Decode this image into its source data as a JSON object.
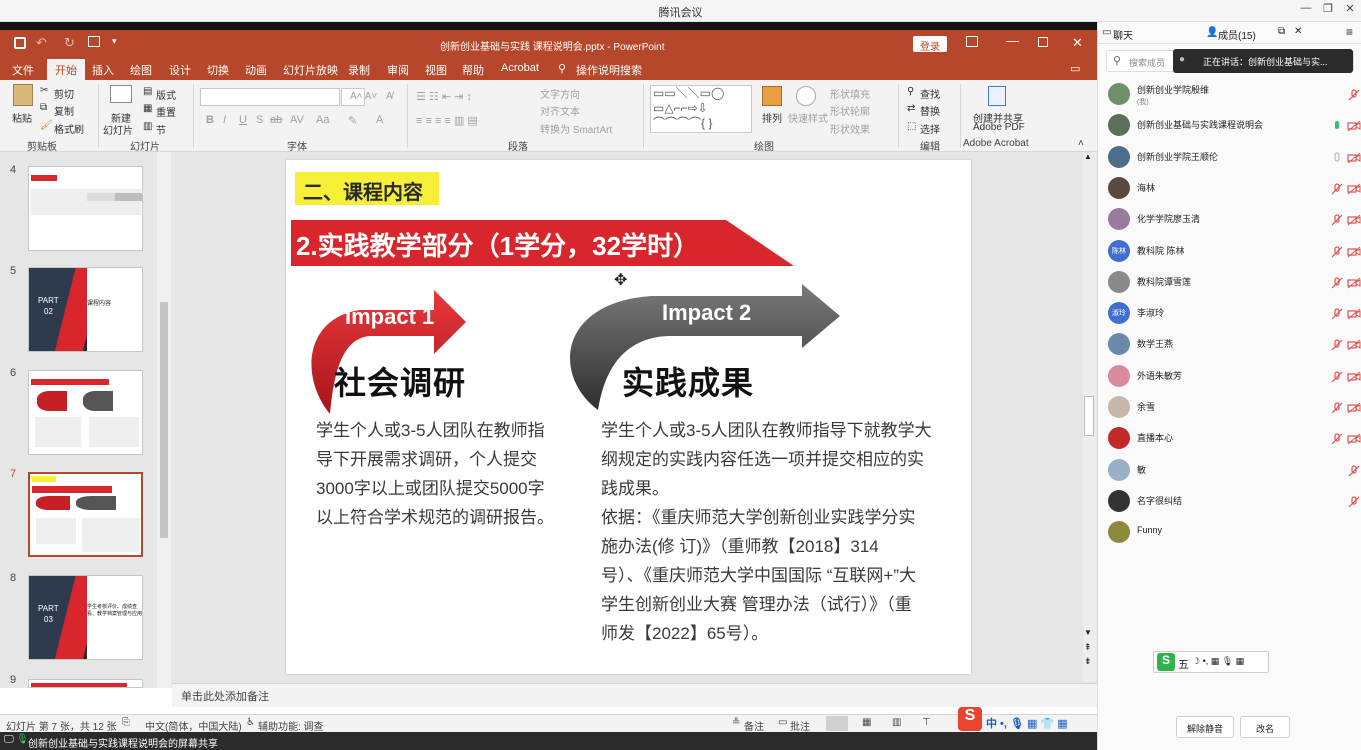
{
  "app": {
    "title": "腾讯会议"
  },
  "ppt": {
    "doc_title": "创新创业基础与实践 课程说明会.pptx - PowerPoint",
    "login": "登录",
    "tabs": [
      "文件",
      "开始",
      "插入",
      "绘图",
      "设计",
      "切换",
      "动画",
      "幻灯片放映",
      "录制",
      "审阅",
      "视图",
      "帮助",
      "Acrobat",
      "操作说明搜索"
    ],
    "ribbon": {
      "paste": "粘贴",
      "cut": "剪切",
      "copy": "复制",
      "format_painter": "格式刷",
      "clipboard": "剪贴板",
      "new_slide": "新建",
      "new_slide2": "幻灯片",
      "layout": "版式",
      "reset": "重置",
      "section": "节",
      "slides": "幻灯片",
      "font": "字体",
      "text_dir": "文字方向",
      "align_text": "对齐文本",
      "smartart": "转换为 SmartArt",
      "paragraph": "段落",
      "arrange": "排列",
      "quick_styles": "快速样式",
      "shape_fill": "形状填充",
      "shape_outline": "形状轮廓",
      "shape_effects": "形状效果",
      "drawing": "绘图",
      "find": "查找",
      "replace": "替换",
      "select": "选择",
      "editing": "编辑",
      "adobe1": "创建并共享",
      "adobe2": "Adobe PDF",
      "adobe_group": "Adobe Acrobat"
    },
    "slide_numbers": [
      "4",
      "5",
      "6",
      "7",
      "8",
      "9"
    ],
    "thumbs": {
      "part02": "PART",
      "part02_num": "02",
      "part02_title": "课程内容",
      "part03": "PART",
      "part03_num": "03",
      "part03_title": "学生考核评价、成绩查看、教学档案管理与应用"
    },
    "slide": {
      "section_label": "二、课程内容",
      "banner": "2.实践教学部分（1学分，32学时）",
      "impact1": "Impact 1",
      "impact2": "Impact 2",
      "heading1": "社会调研",
      "heading2": "实践成果",
      "col1": [
        "学生个人或3-5人团队在教师指",
        "导下开展需求调研，个人提交",
        "3000字以上或团队提交5000字",
        "以上符合学术规范的调研报告。"
      ],
      "col2": [
        "学生个人或3-5人团队在教师指导下就教学大",
        "纲规定的实践内容任选一项并提交相应的实",
        "践成果。",
        "依据：《重庆师范大学创新创业实践学分实",
        "施办法(修 订)》（重师教【2018】314",
        "号）、《重庆师范大学中国国际 “互联网+”大",
        "学生创新创业大赛 管理办法（试行）》（重",
        "师发【2022】65号）。"
      ]
    },
    "notes_placeholder": "单击此处添加备注",
    "status": {
      "slide_info": "幻灯片 第 7 张，共 12 张",
      "language": "中文(简体，中国大陆)",
      "accessibility": "辅助功能: 调查",
      "notes": "备注",
      "comments": "批注"
    },
    "share_bar": "创新创业基础与实践课程说明会的屏幕共享"
  },
  "meeting": {
    "tab_chat": "聊天",
    "tab_members": "成员(15)",
    "search_placeholder": "搜索成员",
    "speaking": "正在讲话：创新创业基础与实...",
    "members": [
      {
        "name": "创新创业学院殷维",
        "sub": "(我)",
        "color": "#6d8f6a"
      },
      {
        "name": "创新创业基础与实践课程说明会",
        "sub": "",
        "color": "#5b6f5a"
      },
      {
        "name": "创新创业学院王顺伦",
        "sub": "",
        "color": "#4d6e8a"
      },
      {
        "name": "海林",
        "sub": "",
        "color": "#5a4a40"
      },
      {
        "name": "化学学院廖玉清",
        "sub": "",
        "color": "#9a7a9e"
      },
      {
        "name": "教科院 陈林",
        "sub": "",
        "color": "#3f6fd1",
        "initials": "陈林"
      },
      {
        "name": "教科院谭雪莲",
        "sub": "",
        "color": "#8a8a8a"
      },
      {
        "name": "李淑玲",
        "sub": "",
        "color": "#3f6fd1",
        "initials": "淑玲"
      },
      {
        "name": "数学王燕",
        "sub": "",
        "color": "#6a8aa8"
      },
      {
        "name": "外语朱敏芳",
        "sub": "",
        "color": "#d88aa0"
      },
      {
        "name": "余雪",
        "sub": "",
        "color": "#c8b8a8"
      },
      {
        "name": "直播本心",
        "sub": "",
        "color": "#c02a2a"
      },
      {
        "name": "敏",
        "sub": "",
        "color": "#9ab0c8"
      },
      {
        "name": "名字很纠结",
        "sub": "",
        "color": "#333333"
      },
      {
        "name": "Funny",
        "sub": "",
        "color": "#8a8a3a"
      }
    ],
    "unmute_all": "解除静音",
    "rename": "改名",
    "ime_label": "五"
  },
  "colors": {
    "ppt_red": "#b7472a",
    "banner_red": "#d9262c",
    "highlight_yellow": "#f5ef38"
  }
}
